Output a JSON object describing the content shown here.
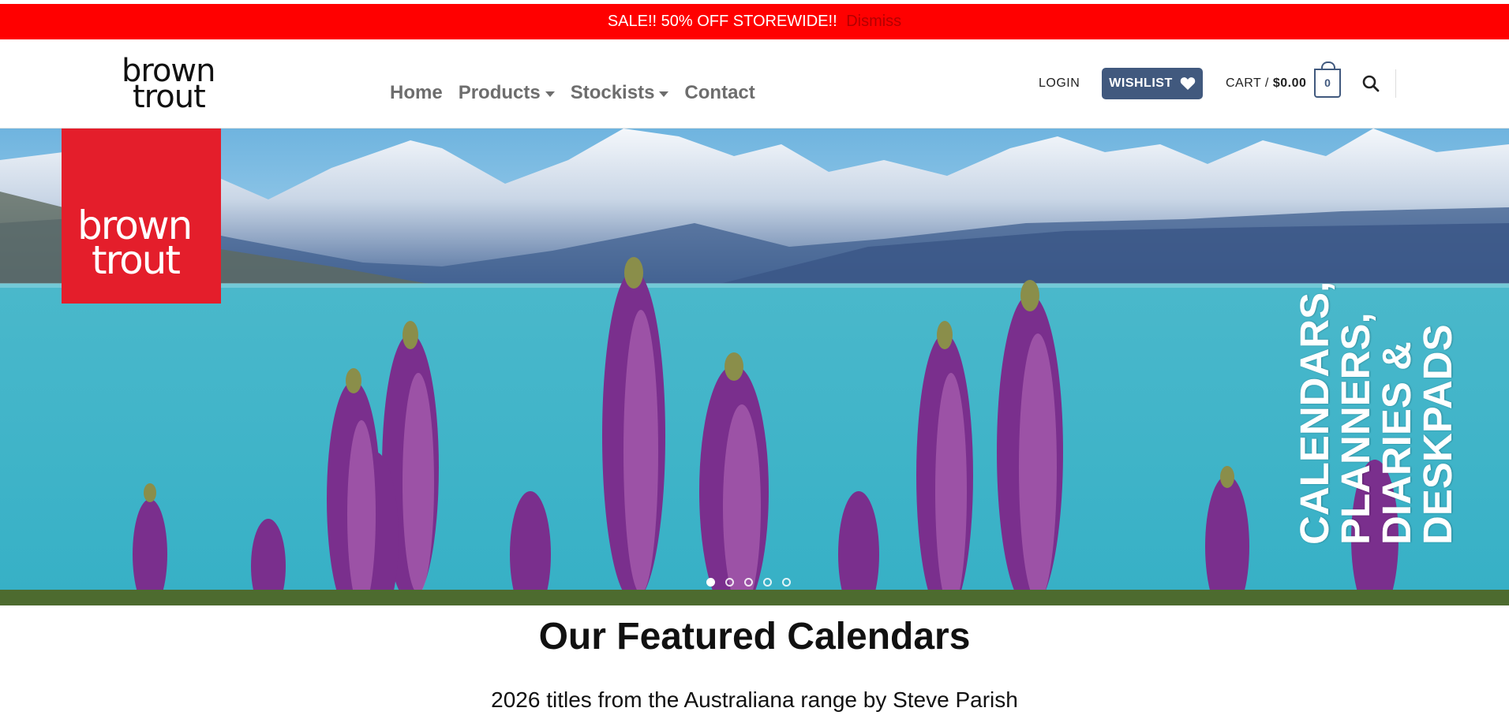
{
  "announcement": {
    "text": "SALE!! 50% OFF STOREWIDE!!",
    "dismiss": "Dismiss",
    "bg": "#ff0000"
  },
  "logo": {
    "line1": "brown",
    "line2": "trout"
  },
  "nav": [
    {
      "label": "Home",
      "dropdown": false
    },
    {
      "label": "Products",
      "dropdown": true
    },
    {
      "label": "Stockists",
      "dropdown": true
    },
    {
      "label": "Contact",
      "dropdown": false
    }
  ],
  "account": {
    "login": "LOGIN",
    "wishlist": "WISHLIST",
    "cart_prefix": "CART /",
    "cart_total": "$0.00",
    "cart_count": "0",
    "accent": "#41597e"
  },
  "hero": {
    "logo_line1": "brown",
    "logo_line2": "trout",
    "logo_bg": "#e41e2b",
    "tagline": [
      "CALENDARS,",
      "PLANNERS,",
      "DIARIES &",
      "DESKPADS"
    ],
    "slide_count": 5,
    "active_slide": 1
  },
  "featured": {
    "title": "Our Featured Calendars",
    "subtitle": "2026 titles from the Australiana range by Steve Parish"
  }
}
